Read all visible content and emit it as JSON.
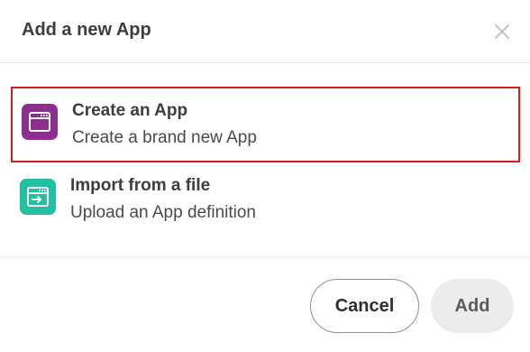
{
  "dialog": {
    "title": "Add a new App",
    "close_icon": "close-icon"
  },
  "options": [
    {
      "title": "Create an App",
      "description": "Create a brand new App",
      "icon": "window-icon",
      "icon_color": "#8e2f8f",
      "selected": true
    },
    {
      "title": "Import from a file",
      "description": "Upload an App definition",
      "icon": "import-window-icon",
      "icon_color": "#22c0a0",
      "selected": false
    }
  ],
  "footer": {
    "cancel_label": "Cancel",
    "add_label": "Add"
  },
  "colors": {
    "selection_border": "#cc1f1f",
    "add_button_bg": "#ececec"
  }
}
